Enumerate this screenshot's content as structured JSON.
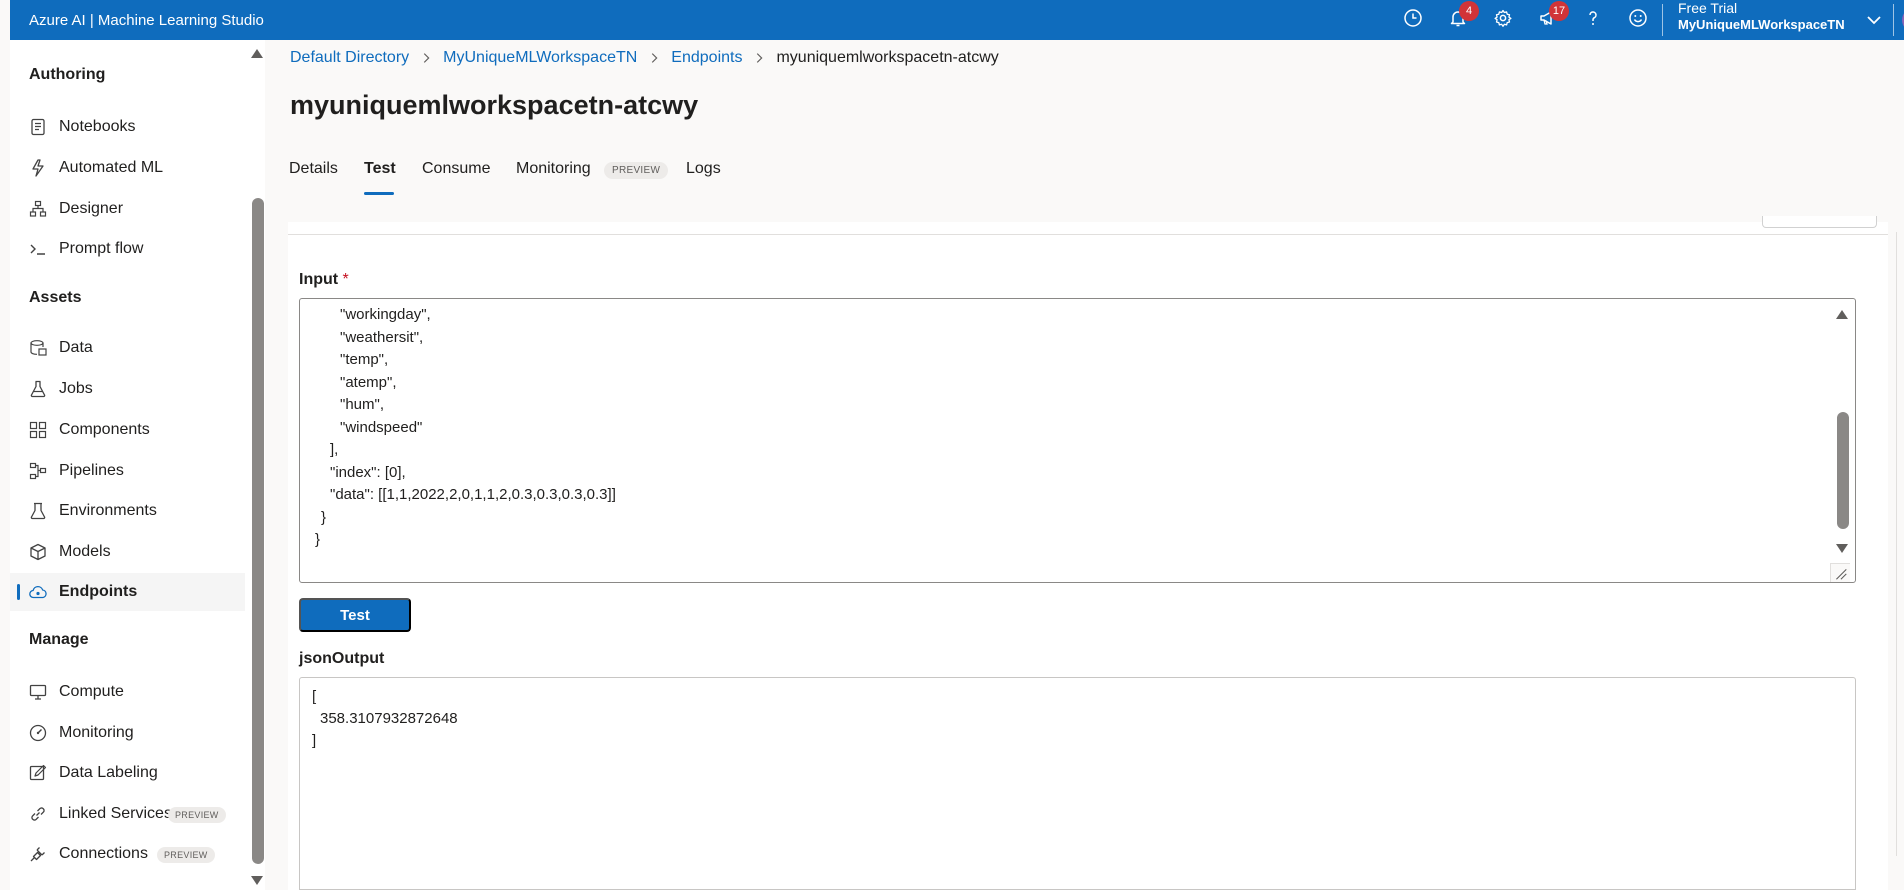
{
  "app": {
    "title": "Azure AI | Machine Learning Studio"
  },
  "topbar": {
    "icons": [
      {
        "name": "clock-icon"
      },
      {
        "name": "bell-icon",
        "badge": "4"
      },
      {
        "name": "gear-icon"
      },
      {
        "name": "megaphone-icon",
        "badge": "17"
      },
      {
        "name": "help-icon"
      },
      {
        "name": "smiley-icon"
      }
    ],
    "account_plan": "Free Trial",
    "account_workspace": "MyUniqueMLWorkspaceTN",
    "badge_color": "#d13438",
    "bar_color": "#0f6cbd"
  },
  "sidebar": {
    "sections": {
      "authoring": "Authoring",
      "assets": "Assets",
      "manage": "Manage"
    },
    "items": [
      {
        "label": "Notebooks",
        "icon": "notebook-icon"
      },
      {
        "label": "Automated ML",
        "icon": "automl-icon"
      },
      {
        "label": "Designer",
        "icon": "designer-icon"
      },
      {
        "label": "Prompt flow",
        "icon": "prompt-icon"
      },
      {
        "label": "Data",
        "icon": "data-icon"
      },
      {
        "label": "Jobs",
        "icon": "flask-icon"
      },
      {
        "label": "Components",
        "icon": "components-icon"
      },
      {
        "label": "Pipelines",
        "icon": "pipelines-icon"
      },
      {
        "label": "Environments",
        "icon": "environments-icon"
      },
      {
        "label": "Models",
        "icon": "cube-icon"
      },
      {
        "label": "Endpoints",
        "icon": "cloud-icon",
        "active": true
      },
      {
        "label": "Compute",
        "icon": "monitor-icon"
      },
      {
        "label": "Monitoring",
        "icon": "gauge-icon"
      },
      {
        "label": "Data Labeling",
        "icon": "edit-icon"
      },
      {
        "label": "Linked Services",
        "icon": "link-icon",
        "pill": "PREVIEW"
      },
      {
        "label": "Connections",
        "icon": "plug-icon",
        "pill": "PREVIEW"
      }
    ]
  },
  "breadcrumb": {
    "items": [
      "Default Directory",
      "MyUniqueMLWorkspaceTN",
      "Endpoints"
    ],
    "current": "myuniquemlworkspacetn-atcwy"
  },
  "page_title": "myuniquemlworkspacetn-atcwy",
  "tabs": {
    "items": [
      "Details",
      "Test",
      "Consume",
      "Monitoring",
      "Logs"
    ],
    "active": "Test",
    "monitoring_pill": "PREVIEW"
  },
  "input": {
    "label": "Input",
    "required_mark": "*",
    "lines": [
      "\"workingday\",",
      "\"weathersit\",",
      "\"temp\",",
      "\"atemp\",",
      "\"hum\",",
      "\"windspeed\"",
      "],",
      "\"index\": [0],",
      "\"data\": [[1,1,2022,2,0,1,1,2,0.3,0.3,0.3,0.3]]",
      "}",
      "}"
    ]
  },
  "test_button": {
    "label": "Test"
  },
  "output": {
    "label": "jsonOutput",
    "lines": [
      "[",
      "358.3107932872648",
      "]"
    ]
  }
}
